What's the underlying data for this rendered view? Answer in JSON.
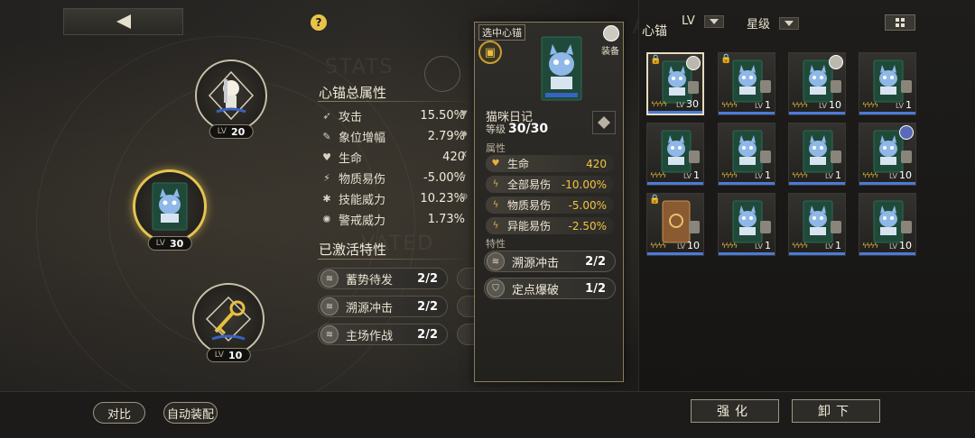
{
  "nav": {
    "help_glyph": "?"
  },
  "slots": [
    {
      "level_prefix": "LV",
      "level": "20"
    },
    {
      "level_prefix": "LV",
      "level": "30"
    },
    {
      "level_prefix": "LV",
      "level": "10"
    }
  ],
  "stats_panel": {
    "title": "心锚总属性",
    "rows": [
      {
        "icon": "attack-icon",
        "name": "攻击",
        "value": "15.50%"
      },
      {
        "icon": "pen-icon",
        "name": "象位增幅",
        "value": "2.79%"
      },
      {
        "icon": "heart-icon",
        "name": "生命",
        "value": "420"
      },
      {
        "icon": "physical-vuln-icon",
        "name": "物质易伤",
        "value": "-5.00%"
      },
      {
        "icon": "skill-icon",
        "name": "技能威力",
        "value": "10.23%"
      },
      {
        "icon": "alert-icon",
        "name": "警戒威力",
        "value": "1.73%"
      }
    ]
  },
  "traits_panel": {
    "title": "已激活特性",
    "traits": [
      {
        "name": "蓄势待发",
        "count": "2/2"
      },
      {
        "name": "溯源冲击",
        "count": "2/2"
      },
      {
        "name": "主场作战",
        "count": "2/2"
      }
    ]
  },
  "detail": {
    "selected_label": "选中心锚",
    "equip_label": "装备",
    "name": "猫咪日记",
    "level_label": "等级",
    "level_value": "30/30",
    "attr_title": "属性",
    "attributes": [
      {
        "name": "生命",
        "value": "420"
      },
      {
        "name": "全部易伤",
        "value": "-10.00%"
      },
      {
        "name": "物质易伤",
        "value": "-5.00%"
      },
      {
        "name": "异能易伤",
        "value": "-2.50%"
      }
    ],
    "trait_title": "特性",
    "traits": [
      {
        "name": "溯源冲击",
        "count": "2/2"
      },
      {
        "name": "定点爆破",
        "count": "1/2"
      }
    ]
  },
  "inventory": {
    "title": "心锚",
    "sort_lv": "LV",
    "sort_star": "星级",
    "items": [
      {
        "level": "30",
        "locked": true,
        "avatar": "grey",
        "selected": true,
        "art": "cat"
      },
      {
        "level": "1",
        "locked": true,
        "avatar": "none",
        "selected": false,
        "art": "cat"
      },
      {
        "level": "10",
        "locked": false,
        "avatar": "grey",
        "selected": false,
        "art": "cat"
      },
      {
        "level": "1",
        "locked": false,
        "avatar": "none",
        "selected": false,
        "art": "cat"
      },
      {
        "level": "1",
        "locked": false,
        "avatar": "none",
        "selected": false,
        "art": "cat"
      },
      {
        "level": "1",
        "locked": false,
        "avatar": "none",
        "selected": false,
        "art": "cat"
      },
      {
        "level": "1",
        "locked": false,
        "avatar": "none",
        "selected": false,
        "art": "cat"
      },
      {
        "level": "10",
        "locked": false,
        "avatar": "blue",
        "selected": false,
        "art": "cat"
      },
      {
        "level": "10",
        "locked": true,
        "avatar": "none",
        "selected": false,
        "art": "book"
      },
      {
        "level": "1",
        "locked": false,
        "avatar": "none",
        "selected": false,
        "art": "cat"
      },
      {
        "level": "1",
        "locked": false,
        "avatar": "none",
        "selected": false,
        "art": "cat"
      },
      {
        "level": "10",
        "locked": false,
        "avatar": "none",
        "selected": false,
        "art": "cat"
      }
    ],
    "level_prefix": "LV"
  },
  "bottom": {
    "compare_label": "对比",
    "auto_equip_label": "自动装配",
    "enhance_label": "强化",
    "unequip_label": "卸下"
  },
  "colors": {
    "accent_gold": "#e6c450",
    "rarity_blue": "#4b7ad8",
    "value_gold": "#f2c442"
  }
}
